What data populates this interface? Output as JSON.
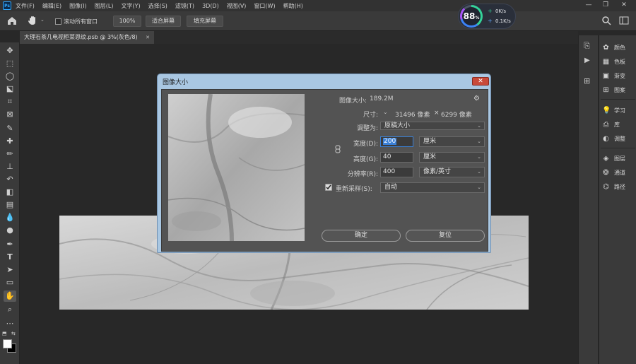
{
  "app": {
    "logo": "Ps",
    "menu": [
      "文件(F)",
      "编辑(E)",
      "图像(I)",
      "图层(L)",
      "文字(Y)",
      "选择(S)",
      "滤镜(T)",
      "3D(D)",
      "视图(V)",
      "窗口(W)",
      "帮助(H)"
    ]
  },
  "window_controls": {
    "minimize": "—",
    "restore": "❐",
    "close": "✕"
  },
  "options_bar": {
    "scroll_all_label": "滚动所有窗口",
    "zoom_value": "100%",
    "fit_screen": "适合屏幕",
    "fill_screen": "填充屏幕"
  },
  "speed_widget": {
    "percent": "88",
    "percent_unit": "%",
    "upload": "0K/s",
    "download": "0.1K/s",
    "up_arrow": "+",
    "down_arrow": "+"
  },
  "document": {
    "tab_title": "大理石茶几电视柜菜恩纹.psb @ 3%(灰色/8)",
    "close_glyph": "✕"
  },
  "right_panel": {
    "items": [
      "颜色",
      "色板",
      "渐变",
      "图案",
      "学习",
      "库",
      "调整",
      "图层",
      "通道",
      "路径"
    ]
  },
  "dialog": {
    "title": "图像大小",
    "close": "✕",
    "image_size_label": "图像大小:",
    "image_size_value": "189.2M",
    "dimensions_label": "尺寸:",
    "dimensions_width": "31496 像素",
    "dimensions_sep": "×",
    "dimensions_height": "6299 像素",
    "fit_to_label": "调整为:",
    "fit_to_value": "原稿大小",
    "width_label": "宽度(D):",
    "width_value": "200",
    "width_unit": "厘米",
    "height_label": "高度(G):",
    "height_value": "40",
    "height_unit": "厘米",
    "resolution_label": "分辨率(R):",
    "resolution_value": "400",
    "resolution_unit": "像素/英寸",
    "resample_label": "重新采样(S):",
    "resample_value": "自动",
    "resample_checked": true,
    "ok_button": "确定",
    "reset_button": "复位"
  }
}
